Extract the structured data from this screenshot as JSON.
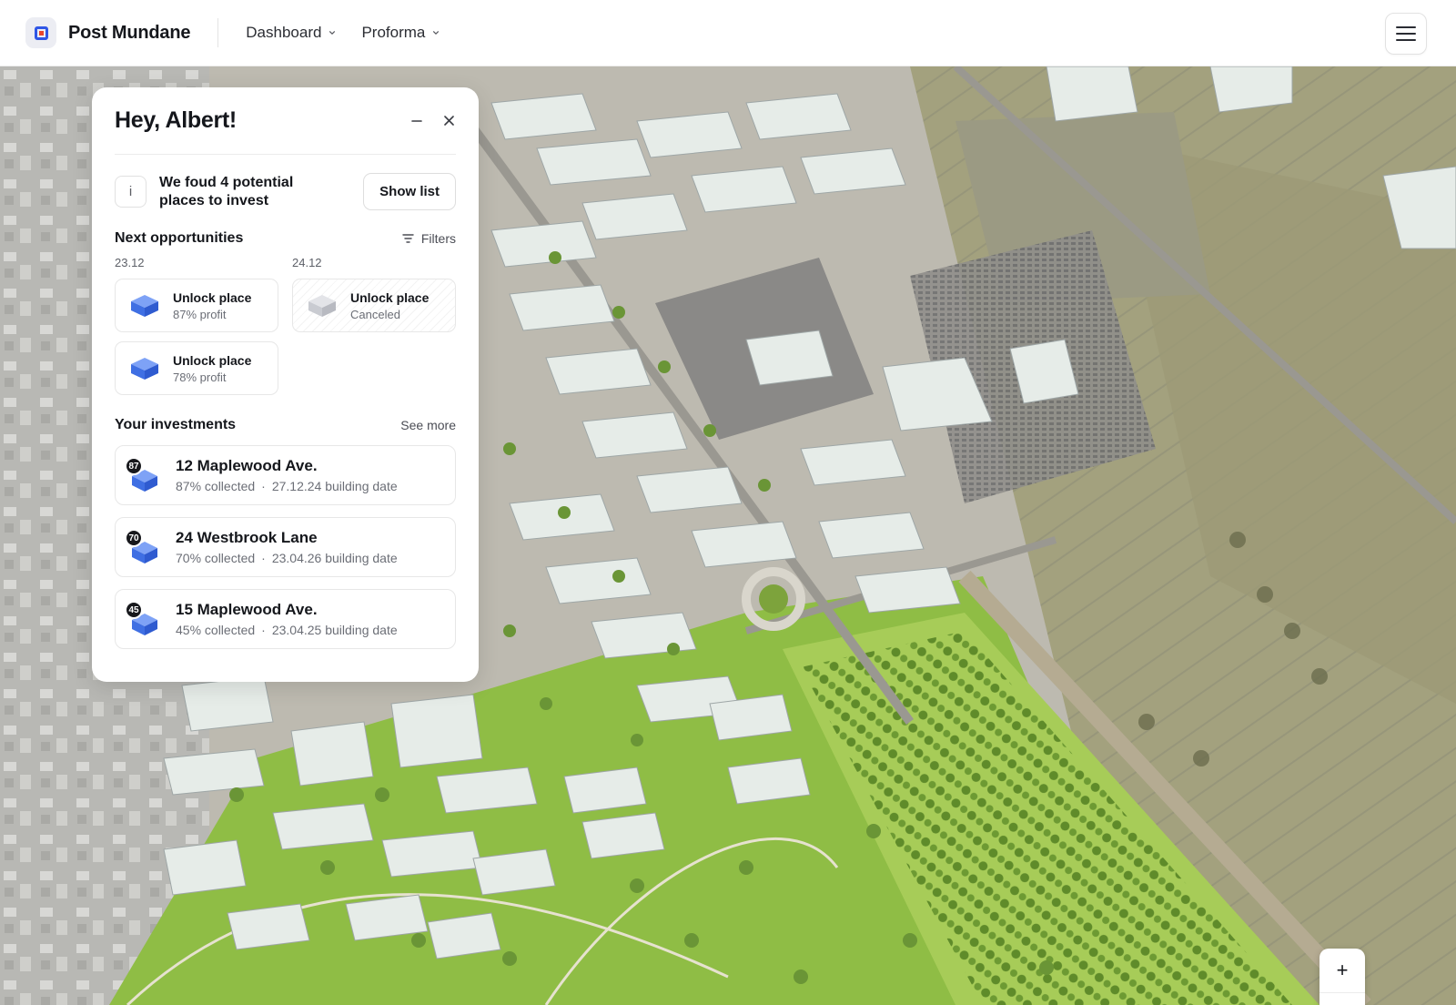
{
  "header": {
    "brand": "Post Mundane",
    "nav": [
      {
        "label": "Dashboard"
      },
      {
        "label": "Proforma"
      }
    ],
    "menu_icon": "hamburger-icon"
  },
  "panel": {
    "title": "Hey, Albert!",
    "info": {
      "icon": "i",
      "text": "We foud 4 potential places to invest",
      "button": "Show list"
    },
    "opportunities": {
      "title": "Next opportunities",
      "filters_label": "Filters",
      "columns": [
        {
          "date": "23.12",
          "cards": [
            {
              "title": "Unlock place",
              "subtitle": "87% profit",
              "status": "active"
            },
            {
              "title": "Unlock place",
              "subtitle": "78% profit",
              "status": "active"
            }
          ]
        },
        {
          "date": "24.12",
          "cards": [
            {
              "title": "Unlock place",
              "subtitle": "Canceled",
              "status": "canceled"
            }
          ]
        }
      ]
    },
    "investments": {
      "title": "Your investments",
      "see_more": "See more",
      "items": [
        {
          "badge": "87",
          "title": "12 Maplewood Ave.",
          "collected": "87% collected",
          "date": "27.12.24 building date"
        },
        {
          "badge": "70",
          "title": "24 Westbrook Lane",
          "collected": "70% collected",
          "date": "23.04.26 building date"
        },
        {
          "badge": "45",
          "title": "15 Maplewood Ave.",
          "collected": "45% collected",
          "date": "23.04.25 building date"
        }
      ]
    }
  },
  "map": {
    "zoom_in": "+",
    "zoom_out": "−"
  },
  "colors": {
    "accent_blue": "#4a78ee",
    "brand_red": "#e8452c",
    "grass": "#9ec64d"
  }
}
